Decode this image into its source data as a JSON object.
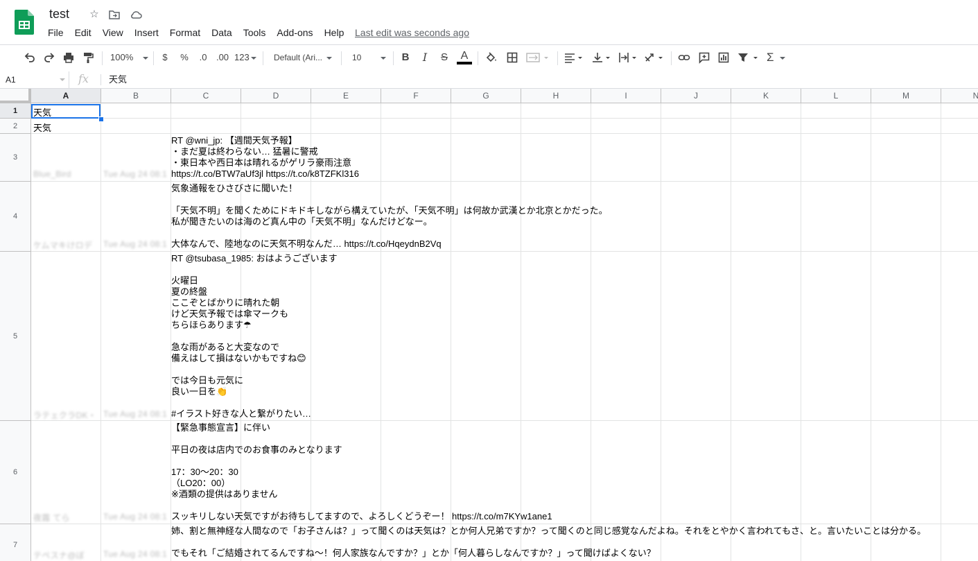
{
  "doc": {
    "title": "test",
    "last_edit": "Last edit was seconds ago"
  },
  "menu": [
    "File",
    "Edit",
    "View",
    "Insert",
    "Format",
    "Data",
    "Tools",
    "Add-ons",
    "Help"
  ],
  "toolbar": {
    "zoom": "100%",
    "currency": "$",
    "percent": "%",
    "dec_decrease": ".0",
    "dec_increase": ".00",
    "more_formats": "123",
    "font": "Default (Ari...",
    "font_size": "10",
    "bold": "B",
    "italic": "I",
    "strike": "S",
    "text_color": "A",
    "text_color_value": "#000000",
    "functions": "Σ"
  },
  "formula": {
    "cell_ref": "A1",
    "fx": "fx",
    "value": "天気"
  },
  "columns": [
    "A",
    "B",
    "C",
    "D",
    "E",
    "F",
    "G",
    "H",
    "I",
    "J",
    "K",
    "L",
    "M",
    "N"
  ],
  "rows": [
    {
      "num": "1",
      "a": "天気",
      "b": "",
      "c": ""
    },
    {
      "num": "2",
      "a": "天気",
      "b": "",
      "c": ""
    },
    {
      "num": "3",
      "a": "Blue_Bird",
      "b": "Tue Aug 24 08:1",
      "c": "RT @wni_jp: 【週間天気予報】\n・まだ夏は終わらない… 猛暑に警戒\n・東日本や西日本は晴れるがゲリラ豪雨注意\nhttps://t.co/BTW7aUf3jl https://t.co/k8TZFKl316"
    },
    {
      "num": "4",
      "a": "ケムマキけロデ",
      "b": "Tue Aug 24 08:1",
      "c": "気象通報をひさびさに聞いた！\n\n「天気不明」を聞くためにドキドキしながら構えていたが、「天気不明」は何故か武漢とか北京とかだった。\n私が聞きたいのは海のど真ん中の「天気不明」なんだけどなー。\n\n大体なんで、陸地なのに天気不明なんだ… https://t.co/HqeydnB2Vq"
    },
    {
      "num": "5",
      "a": "ラテェクラDK・",
      "b": "Tue Aug 24 08:1",
      "c": "RT @tsubasa_1985: おはようございます\n\n火曜日\n夏の終盤\nここぞとばかりに晴れた朝\nけど天気予報では傘マークも\nちらほらあります☂\n\n急な雨があると大変なので\n備えはして損はないかもですね😊\n\nでは今日も元気に\n良い一日を👏\n\n#イラスト好きな人と繋がりたい…"
    },
    {
      "num": "6",
      "a": "夜霧 てら",
      "b": "Tue Aug 24 08:1",
      "c": "【緊急事態宣言】に伴い\n\n平日の夜は店内でのお食事のみとなります\n\n17：30～20：30\n（LO20：00）\n※酒類の提供はありません\n\nスッキリしない天気ですがお待ちしてますので、よろしくどうぞー！ https://t.co/m7KYw1ane1"
    },
    {
      "num": "7",
      "a": "テペスナ@ぼ",
      "b": "Tue Aug 24 08:1",
      "c": "姉、割と無神経な人間なので「お子さんは？」って聞くのは天気は？とか何人兄弟ですか？って聞くのと同じ感覚なんだよね。それをとやかく言われてもさ、と。言いたいことは分かる。\n\nでもそれ「ご結婚されてるんですね～！何人家族なんですか？」とか「何人暮らしなんですか？」って聞けばよくない？"
    }
  ]
}
